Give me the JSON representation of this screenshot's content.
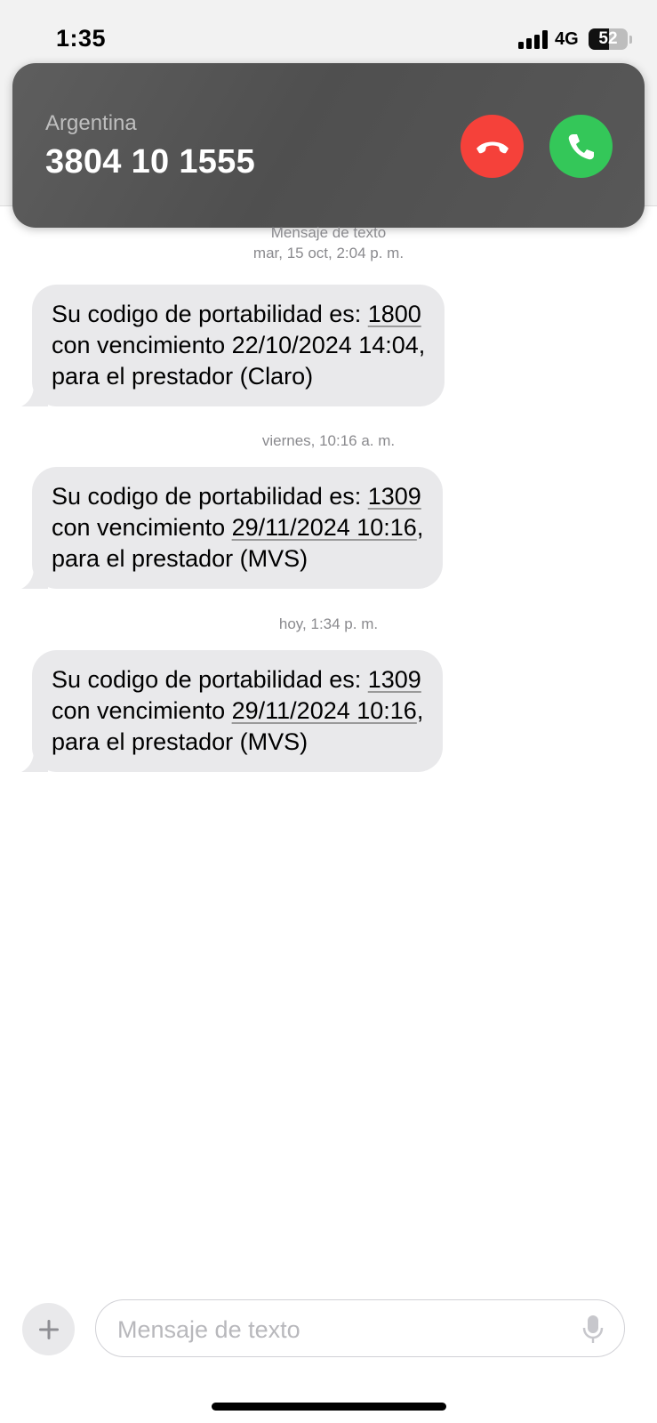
{
  "status_bar": {
    "time": "1:35",
    "network": "4G",
    "battery": "52",
    "battery_level_percent": 52
  },
  "incoming_call": {
    "region": "Argentina",
    "number": "3804 10 1555",
    "decline_icon": "phone-down-icon",
    "accept_icon": "phone-icon",
    "decline_color": "#f5413a",
    "accept_color": "#34c759"
  },
  "conversation": {
    "header_label": "Mensaje de texto",
    "groups": [
      {
        "timestamp": "mar, 15 oct, 2:04 p. m.",
        "message": {
          "line1_prefix": "Su codigo de portabilidad es: ",
          "code": "1800",
          "line2_prefix": "con vencimiento ",
          "expiry": "22/10/2024 14:04,",
          "line3": "para el prestador (Claro)"
        }
      },
      {
        "timestamp": "viernes, 10:16 a. m.",
        "message": {
          "line1_prefix": "Su codigo de portabilidad es: ",
          "code": "1309",
          "line2_prefix": "con vencimiento ",
          "expiry": "29/11/2024 10:16",
          "expiry_suffix": ",",
          "line3": "para el prestador (MVS)"
        }
      },
      {
        "timestamp": "hoy, 1:34 p. m.",
        "message": {
          "line1_prefix": "Su codigo de portabilidad es: ",
          "code": "1309",
          "line2_prefix": "con vencimiento ",
          "expiry": "29/11/2024 10:16",
          "expiry_suffix": ",",
          "line3": "para el prestador (MVS)"
        }
      }
    ]
  },
  "composer": {
    "placeholder": "Mensaje de texto",
    "plus_icon": "plus-icon",
    "mic_icon": "microphone-icon"
  },
  "colors": {
    "bubble_received": "#e9e9eb",
    "timestamp_text": "#8a8a8e"
  }
}
